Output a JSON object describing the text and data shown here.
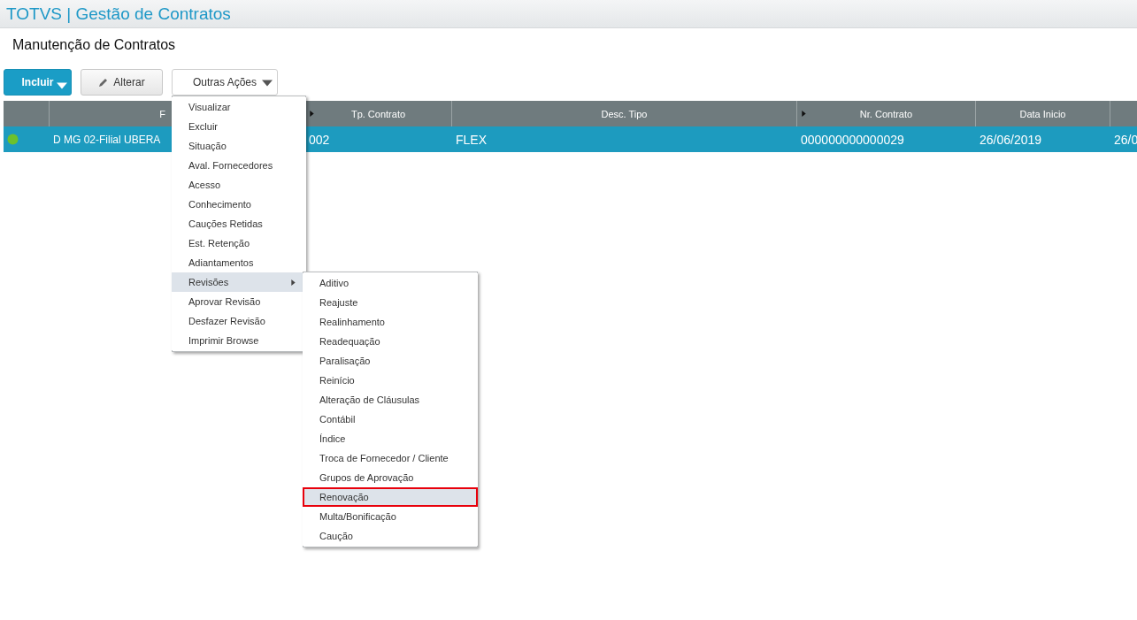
{
  "app_title": "TOTVS | Gestão de Contratos",
  "page_title": "Manutenção de Contratos",
  "toolbar": [
    {
      "kind": "primary",
      "label": "Incluir"
    },
    {
      "kind": "edit",
      "label": "Alterar"
    },
    {
      "kind": "dropdown",
      "label": "Outras Ações"
    }
  ],
  "table": {
    "columns": [
      {
        "kind": "text",
        "label": "F",
        "sortable": false
      },
      {
        "kind": "text",
        "label": "Tp. Contrato",
        "sortable": true
      },
      {
        "kind": "text",
        "label": "Desc. Tipo",
        "sortable": false
      },
      {
        "kind": "text",
        "label": "Nr. Contrato",
        "sortable": true
      },
      {
        "kind": "text",
        "label": "Data Inicio",
        "sortable": false
      },
      {
        "kind": "blank"
      }
    ],
    "rows": [
      {
        "selected": true,
        "color": "#6cc12c",
        "cells": [
          "D MG 02-Filial UBERA",
          "002",
          "FLEX",
          "000000000000029",
          "26/06/2019",
          "26/0"
        ]
      }
    ]
  },
  "menu": {
    "items": [
      {
        "label": "Visualizar",
        "selected": false
      },
      {
        "label": "Excluir",
        "selected": false
      },
      {
        "label": "Situação",
        "selected": false
      },
      {
        "label": "Aval. Fornecedores",
        "selected": false
      },
      {
        "label": "Acesso",
        "selected": false
      },
      {
        "label": "Conhecimento",
        "selected": false
      },
      {
        "label": "Cauções Retidas",
        "selected": false
      },
      {
        "label": "Est. Retenção",
        "selected": false
      },
      {
        "label": "Adiantamentos",
        "selected": false
      },
      {
        "label": "Revisões",
        "selected": true,
        "submenu": true
      },
      {
        "label": "Aprovar Revisão",
        "selected": false
      },
      {
        "label": "Desfazer Revisão",
        "selected": false
      },
      {
        "label": "Imprimir Browse",
        "selected": false
      }
    ]
  },
  "submenu": {
    "items": [
      {
        "label": "Aditivo",
        "selected": false,
        "outlined": false
      },
      {
        "label": "Reajuste",
        "selected": false,
        "outlined": false
      },
      {
        "label": "Realinhamento",
        "selected": false,
        "outlined": false
      },
      {
        "label": "Readequação",
        "selected": false,
        "outlined": false
      },
      {
        "label": "Paralisação",
        "selected": false,
        "outlined": false
      },
      {
        "label": "Reinício",
        "selected": false,
        "outlined": false
      },
      {
        "label": "Alteração de Cláusulas",
        "selected": false,
        "outlined": false
      },
      {
        "label": "Contábil",
        "selected": false,
        "outlined": false
      },
      {
        "label": "Índice",
        "selected": false,
        "outlined": false
      },
      {
        "label": "Troca de Fornecedor / Cliente",
        "selected": false,
        "outlined": false
      },
      {
        "label": "Grupos de Aprovação",
        "selected": false,
        "outlined": false
      },
      {
        "label": "Renovação",
        "selected": true,
        "outlined": true
      },
      {
        "label": "Multa/Bonificação",
        "selected": false,
        "outlined": false
      },
      {
        "label": "Caução",
        "selected": false,
        "outlined": false
      }
    ]
  }
}
